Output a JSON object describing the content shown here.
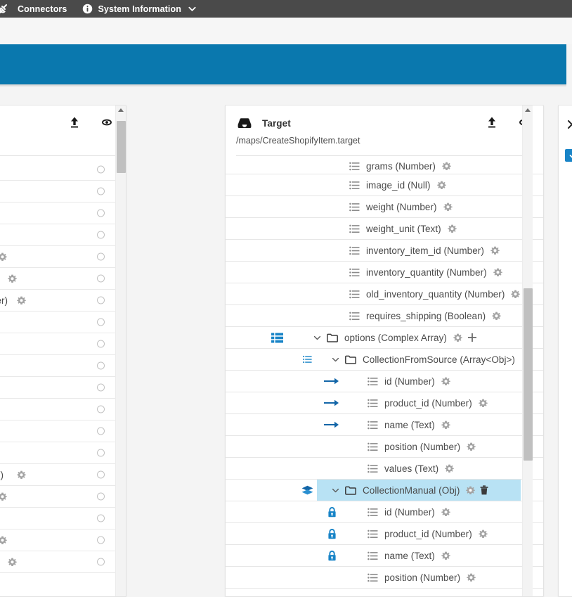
{
  "topnav": {
    "items": [
      {
        "label": "Connectors",
        "icon": "plug-icon",
        "caret": false
      },
      {
        "label": "System Information",
        "icon": "info-icon",
        "caret": true
      }
    ]
  },
  "banner": {
    "color": "#0a78ae"
  },
  "panels": {
    "source": {
      "name": "source-panel",
      "actions": [
        {
          "icon": "upload-icon",
          "name": "upload-button"
        },
        {
          "icon": "eye-icon",
          "name": "preview-button"
        }
      ],
      "rows": [
        {
          "fragment": "",
          "gear": false
        },
        {
          "fragment": "",
          "gear": false
        },
        {
          "fragment": "",
          "gear": false
        },
        {
          "fragment": "",
          "gear": false
        },
        {
          "fragment": "",
          "gear": true
        },
        {
          "fragment": ")",
          "gear": true
        },
        {
          "fragment": "ber)",
          "gear": true
        },
        {
          "fragment": "",
          "gear": false
        },
        {
          "fragment": "",
          "gear": false
        },
        {
          "fragment": "",
          "gear": false
        },
        {
          "fragment": "",
          "gear": false
        },
        {
          "fragment": "",
          "gear": false
        },
        {
          "fragment": "",
          "gear": false
        },
        {
          "fragment": "",
          "gear": false
        },
        {
          "fragment": "ull)",
          "gear": true
        },
        {
          "fragment": "",
          "gear": true
        },
        {
          "fragment": "",
          "gear": false
        },
        {
          "fragment": "",
          "gear": true
        },
        {
          "fragment": ")",
          "gear": true
        }
      ]
    },
    "target": {
      "title": "Target",
      "path": "/maps/CreateShopifyItem.target",
      "icon": "tray-icon",
      "actions": [
        {
          "icon": "upload-icon",
          "name": "upload-button"
        },
        {
          "icon": "eye-icon",
          "name": "preview-button"
        }
      ],
      "tree": [
        {
          "label": "grams (Number)",
          "indent": 4,
          "kind": "field",
          "gutter": "none",
          "gear": true,
          "clipped": true
        },
        {
          "label": "image_id (Null)",
          "indent": 4,
          "kind": "field",
          "gutter": "none",
          "gear": true
        },
        {
          "label": "weight (Number)",
          "indent": 4,
          "kind": "field",
          "gutter": "none",
          "gear": true
        },
        {
          "label": "weight_unit (Text)",
          "indent": 4,
          "kind": "field",
          "gutter": "none",
          "gear": true
        },
        {
          "label": "inventory_item_id (Number)",
          "indent": 4,
          "kind": "field",
          "gutter": "none",
          "gear": true
        },
        {
          "label": "inventory_quantity (Number)",
          "indent": 4,
          "kind": "field",
          "gutter": "none",
          "gear": true
        },
        {
          "label": "old_inventory_quantity (Number)",
          "indent": 4,
          "kind": "field",
          "gutter": "none",
          "gear": true
        },
        {
          "label": "requires_shipping (Boolean)",
          "indent": 4,
          "kind": "field",
          "gutter": "none",
          "gear": true
        },
        {
          "label": "options (Complex Array)",
          "indent": 2,
          "kind": "folder",
          "gutter": "blue-list",
          "gear": true,
          "plus": true,
          "expanded": true
        },
        {
          "label": "CollectionFromSource (Array<Obj>)",
          "indent": 3,
          "kind": "folder",
          "gutter": "blue-list-sm",
          "gear": false,
          "expanded": true
        },
        {
          "label": "id (Number)",
          "indent": 5,
          "kind": "field",
          "gutter": "arrow",
          "gear": true
        },
        {
          "label": "product_id (Number)",
          "indent": 5,
          "kind": "field",
          "gutter": "arrow",
          "gear": true
        },
        {
          "label": "name (Text)",
          "indent": 5,
          "kind": "field",
          "gutter": "arrow",
          "gear": true
        },
        {
          "label": "position (Number)",
          "indent": 5,
          "kind": "field",
          "gutter": "none",
          "gear": true
        },
        {
          "label": "values (Text)",
          "indent": 5,
          "kind": "field",
          "gutter": "none",
          "gear": true
        },
        {
          "label": "CollectionManual (Obj)",
          "indent": 3,
          "kind": "folder",
          "gutter": "layers",
          "gear": true,
          "trash": true,
          "expanded": true,
          "selected": true
        },
        {
          "label": "id (Number)",
          "indent": 5,
          "kind": "field",
          "gutter": "lock",
          "gear": true
        },
        {
          "label": "product_id (Number)",
          "indent": 5,
          "kind": "field",
          "gutter": "lock",
          "gear": true
        },
        {
          "label": "name (Text)",
          "indent": 5,
          "kind": "field",
          "gutter": "lock",
          "gear": true
        },
        {
          "label": "position (Number)",
          "indent": 5,
          "kind": "field",
          "gutter": "none",
          "gear": true,
          "clipped": true
        }
      ]
    },
    "right": {
      "name": "inspector-panel",
      "close_icon": "close-icon",
      "badge_color": "#1884c7"
    }
  },
  "colors": {
    "nav_bg": "#4a4a4a",
    "banner_blue": "#0a78ae",
    "selection_blue": "#b8e2f4",
    "accent_blue": "#1884c7",
    "text_gray": "#4a4a4a"
  }
}
